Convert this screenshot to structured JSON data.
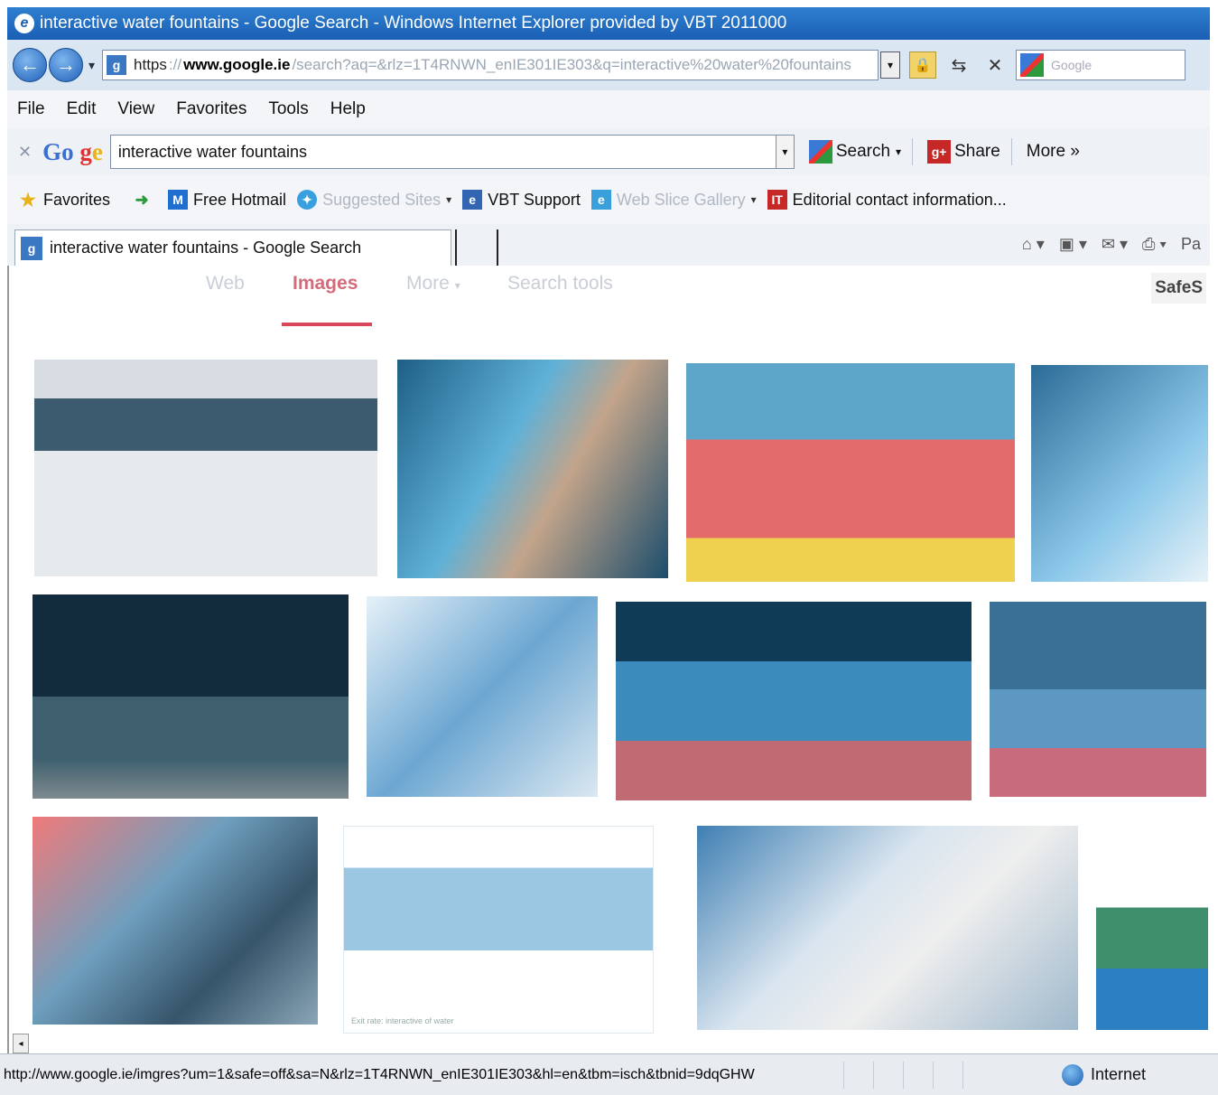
{
  "window": {
    "title": "interactive water fountains - Google Search - Windows Internet Explorer provided by VBT 2011000"
  },
  "address_bar": {
    "scheme": "https",
    "domain": "www.google.ie",
    "path": "/search?aq=&rlz=1T4RNWN_enIE301IE303&q=interactive%20water%20fountains"
  },
  "search_box": {
    "placeholder": "Google"
  },
  "menu": [
    "File",
    "Edit",
    "View",
    "Favorites",
    "Tools",
    "Help"
  ],
  "google_toolbar": {
    "logo": [
      "Go",
      "g",
      "e"
    ],
    "query": "interactive water fountains",
    "search_label": "Search",
    "share_label": "Share",
    "more_label": "More »"
  },
  "favorites_bar": {
    "favorites_label": "Favorites",
    "items": [
      {
        "label": "Free Hotmail",
        "muted": false
      },
      {
        "label": "Suggested Sites",
        "muted": true
      },
      {
        "label": "VBT Support",
        "muted": false
      },
      {
        "label": "Web Slice Gallery",
        "muted": true
      },
      {
        "label": "Editorial contact information...",
        "muted": false
      }
    ]
  },
  "tab": {
    "title": "interactive water fountains - Google Search"
  },
  "command_bar": {
    "page_label": "Pa"
  },
  "google_nav": {
    "items": [
      "Web",
      "Images",
      "More",
      "Search tools"
    ],
    "active": "Images",
    "safesearch": "SafeS"
  },
  "image_caption": "Exit rate: interactive of water",
  "status": {
    "url": "http://www.google.ie/imgres?um=1&safe=off&sa=N&rlz=1T4RNWN_enIE301IE303&hl=en&tbm=isch&tbnid=9dqGHW",
    "zone": "Internet"
  },
  "colors": {
    "titlebar": "#1a5fb4",
    "images_tab_active": "#d9475a"
  }
}
